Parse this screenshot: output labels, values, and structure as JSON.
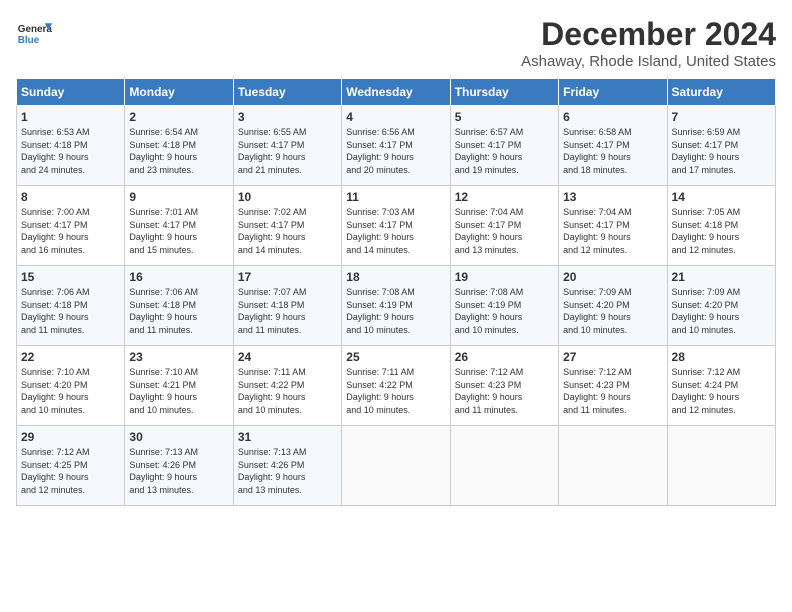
{
  "header": {
    "logo_line1": "General",
    "logo_line2": "Blue",
    "month": "December 2024",
    "location": "Ashaway, Rhode Island, United States"
  },
  "days_of_week": [
    "Sunday",
    "Monday",
    "Tuesday",
    "Wednesday",
    "Thursday",
    "Friday",
    "Saturday"
  ],
  "weeks": [
    [
      {
        "day": "1",
        "lines": [
          "Sunrise: 6:53 AM",
          "Sunset: 4:18 PM",
          "Daylight: 9 hours",
          "and 24 minutes."
        ]
      },
      {
        "day": "2",
        "lines": [
          "Sunrise: 6:54 AM",
          "Sunset: 4:18 PM",
          "Daylight: 9 hours",
          "and 23 minutes."
        ]
      },
      {
        "day": "3",
        "lines": [
          "Sunrise: 6:55 AM",
          "Sunset: 4:17 PM",
          "Daylight: 9 hours",
          "and 21 minutes."
        ]
      },
      {
        "day": "4",
        "lines": [
          "Sunrise: 6:56 AM",
          "Sunset: 4:17 PM",
          "Daylight: 9 hours",
          "and 20 minutes."
        ]
      },
      {
        "day": "5",
        "lines": [
          "Sunrise: 6:57 AM",
          "Sunset: 4:17 PM",
          "Daylight: 9 hours",
          "and 19 minutes."
        ]
      },
      {
        "day": "6",
        "lines": [
          "Sunrise: 6:58 AM",
          "Sunset: 4:17 PM",
          "Daylight: 9 hours",
          "and 18 minutes."
        ]
      },
      {
        "day": "7",
        "lines": [
          "Sunrise: 6:59 AM",
          "Sunset: 4:17 PM",
          "Daylight: 9 hours",
          "and 17 minutes."
        ]
      }
    ],
    [
      {
        "day": "8",
        "lines": [
          "Sunrise: 7:00 AM",
          "Sunset: 4:17 PM",
          "Daylight: 9 hours",
          "and 16 minutes."
        ]
      },
      {
        "day": "9",
        "lines": [
          "Sunrise: 7:01 AM",
          "Sunset: 4:17 PM",
          "Daylight: 9 hours",
          "and 15 minutes."
        ]
      },
      {
        "day": "10",
        "lines": [
          "Sunrise: 7:02 AM",
          "Sunset: 4:17 PM",
          "Daylight: 9 hours",
          "and 14 minutes."
        ]
      },
      {
        "day": "11",
        "lines": [
          "Sunrise: 7:03 AM",
          "Sunset: 4:17 PM",
          "Daylight: 9 hours",
          "and 14 minutes."
        ]
      },
      {
        "day": "12",
        "lines": [
          "Sunrise: 7:04 AM",
          "Sunset: 4:17 PM",
          "Daylight: 9 hours",
          "and 13 minutes."
        ]
      },
      {
        "day": "13",
        "lines": [
          "Sunrise: 7:04 AM",
          "Sunset: 4:17 PM",
          "Daylight: 9 hours",
          "and 12 minutes."
        ]
      },
      {
        "day": "14",
        "lines": [
          "Sunrise: 7:05 AM",
          "Sunset: 4:18 PM",
          "Daylight: 9 hours",
          "and 12 minutes."
        ]
      }
    ],
    [
      {
        "day": "15",
        "lines": [
          "Sunrise: 7:06 AM",
          "Sunset: 4:18 PM",
          "Daylight: 9 hours",
          "and 11 minutes."
        ]
      },
      {
        "day": "16",
        "lines": [
          "Sunrise: 7:06 AM",
          "Sunset: 4:18 PM",
          "Daylight: 9 hours",
          "and 11 minutes."
        ]
      },
      {
        "day": "17",
        "lines": [
          "Sunrise: 7:07 AM",
          "Sunset: 4:18 PM",
          "Daylight: 9 hours",
          "and 11 minutes."
        ]
      },
      {
        "day": "18",
        "lines": [
          "Sunrise: 7:08 AM",
          "Sunset: 4:19 PM",
          "Daylight: 9 hours",
          "and 10 minutes."
        ]
      },
      {
        "day": "19",
        "lines": [
          "Sunrise: 7:08 AM",
          "Sunset: 4:19 PM",
          "Daylight: 9 hours",
          "and 10 minutes."
        ]
      },
      {
        "day": "20",
        "lines": [
          "Sunrise: 7:09 AM",
          "Sunset: 4:20 PM",
          "Daylight: 9 hours",
          "and 10 minutes."
        ]
      },
      {
        "day": "21",
        "lines": [
          "Sunrise: 7:09 AM",
          "Sunset: 4:20 PM",
          "Daylight: 9 hours",
          "and 10 minutes."
        ]
      }
    ],
    [
      {
        "day": "22",
        "lines": [
          "Sunrise: 7:10 AM",
          "Sunset: 4:20 PM",
          "Daylight: 9 hours",
          "and 10 minutes."
        ]
      },
      {
        "day": "23",
        "lines": [
          "Sunrise: 7:10 AM",
          "Sunset: 4:21 PM",
          "Daylight: 9 hours",
          "and 10 minutes."
        ]
      },
      {
        "day": "24",
        "lines": [
          "Sunrise: 7:11 AM",
          "Sunset: 4:22 PM",
          "Daylight: 9 hours",
          "and 10 minutes."
        ]
      },
      {
        "day": "25",
        "lines": [
          "Sunrise: 7:11 AM",
          "Sunset: 4:22 PM",
          "Daylight: 9 hours",
          "and 10 minutes."
        ]
      },
      {
        "day": "26",
        "lines": [
          "Sunrise: 7:12 AM",
          "Sunset: 4:23 PM",
          "Daylight: 9 hours",
          "and 11 minutes."
        ]
      },
      {
        "day": "27",
        "lines": [
          "Sunrise: 7:12 AM",
          "Sunset: 4:23 PM",
          "Daylight: 9 hours",
          "and 11 minutes."
        ]
      },
      {
        "day": "28",
        "lines": [
          "Sunrise: 7:12 AM",
          "Sunset: 4:24 PM",
          "Daylight: 9 hours",
          "and 12 minutes."
        ]
      }
    ],
    [
      {
        "day": "29",
        "lines": [
          "Sunrise: 7:12 AM",
          "Sunset: 4:25 PM",
          "Daylight: 9 hours",
          "and 12 minutes."
        ]
      },
      {
        "day": "30",
        "lines": [
          "Sunrise: 7:13 AM",
          "Sunset: 4:26 PM",
          "Daylight: 9 hours",
          "and 13 minutes."
        ]
      },
      {
        "day": "31",
        "lines": [
          "Sunrise: 7:13 AM",
          "Sunset: 4:26 PM",
          "Daylight: 9 hours",
          "and 13 minutes."
        ]
      },
      {
        "day": "",
        "lines": []
      },
      {
        "day": "",
        "lines": []
      },
      {
        "day": "",
        "lines": []
      },
      {
        "day": "",
        "lines": []
      }
    ]
  ]
}
